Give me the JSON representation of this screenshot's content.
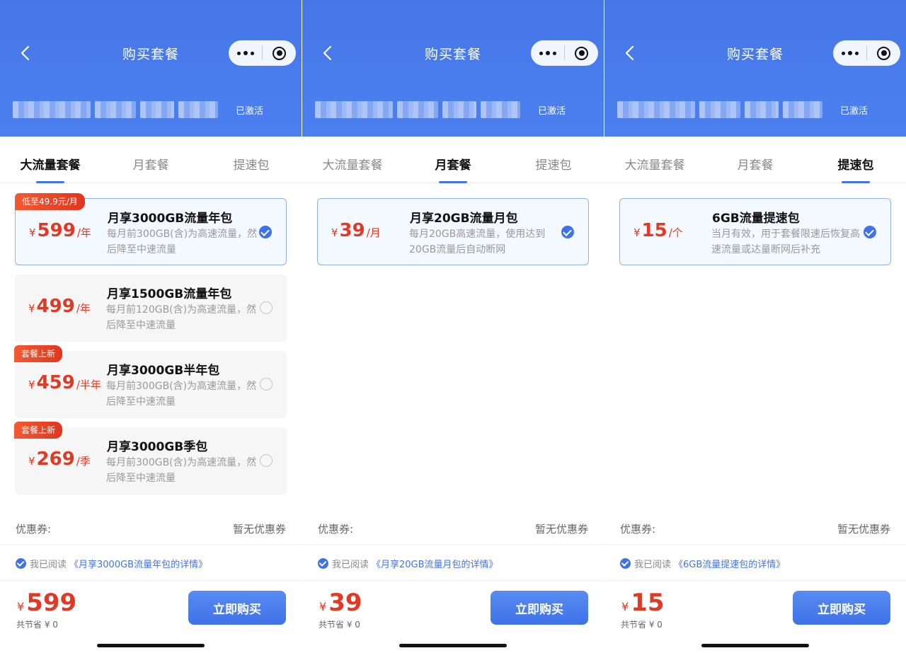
{
  "screens": [
    {
      "nav_title": "购买套餐",
      "status": "已激活",
      "tabs": [
        "大流量套餐",
        "月套餐",
        "提速包"
      ],
      "active_tab": 0,
      "cards": [
        {
          "badge": "低至49.9元/月",
          "currency": "¥",
          "amount": "599",
          "unit": "/年",
          "title": "月享3000GB流量年包",
          "desc": "每月前300GB(含)为高速流量，然后降至中速流量",
          "selected": true
        },
        {
          "badge": "",
          "currency": "¥",
          "amount": "499",
          "unit": "/年",
          "title": "月享1500GB流量年包",
          "desc": "每月前120GB(含)为高速流量，然后降至中速流量",
          "selected": false
        },
        {
          "badge": "套餐上新",
          "currency": "¥",
          "amount": "459",
          "unit": "/半年",
          "title": "月享3000GB半年包",
          "desc": "每月前300GB(含)为高速流量，然后降至中速流量",
          "selected": false
        },
        {
          "badge": "套餐上新",
          "currency": "¥",
          "amount": "269",
          "unit": "/季",
          "title": "月享3000GB季包",
          "desc": "每月前300GB(含)为高速流量，然后降至中速流量",
          "selected": false
        }
      ],
      "coupon_label": "优惠券:",
      "coupon_value": "暂无优惠券",
      "agree_text": "我已阅读",
      "agree_link": "《月享3000GB流量年包的详情》",
      "total_currency": "¥",
      "total_amount": "599",
      "saved": "共节省 ¥ 0",
      "buy_label": "立即购买"
    },
    {
      "nav_title": "购买套餐",
      "status": "已激活",
      "tabs": [
        "大流量套餐",
        "月套餐",
        "提速包"
      ],
      "active_tab": 1,
      "cards": [
        {
          "badge": "",
          "currency": "¥",
          "amount": "39",
          "unit": "/月",
          "title": "月享20GB流量月包",
          "desc": "每月20GB高速流量，使用达到20GB流量后自动断网",
          "selected": true
        }
      ],
      "coupon_label": "优惠券:",
      "coupon_value": "暂无优惠券",
      "agree_text": "我已阅读",
      "agree_link": "《月享20GB流量月包的详情》",
      "total_currency": "¥",
      "total_amount": "39",
      "saved": "共节省 ¥ 0",
      "buy_label": "立即购买"
    },
    {
      "nav_title": "购买套餐",
      "status": "已激活",
      "tabs": [
        "大流量套餐",
        "月套餐",
        "提速包"
      ],
      "active_tab": 2,
      "cards": [
        {
          "badge": "",
          "currency": "¥",
          "amount": "15",
          "unit": "/个",
          "title": "6GB流量提速包",
          "desc": "当月有效，用于套餐限速后恢复高速流量或达量断网后补充",
          "selected": true
        }
      ],
      "coupon_label": "优惠券:",
      "coupon_value": "暂无优惠券",
      "agree_text": "我已阅读",
      "agree_link": "《6GB流量提速包的详情》",
      "total_currency": "¥",
      "total_amount": "15",
      "saved": "共节省 ¥ 0",
      "buy_label": "立即购买"
    }
  ],
  "icons": {
    "back": "chevron-left-icon",
    "more": "more-dots-icon",
    "close": "target-icon",
    "check": "check-circle-icon"
  },
  "colors": {
    "header": "#4a7cee",
    "accent": "#3e72e8",
    "price": "#e03a24",
    "badge": "#e8442a"
  }
}
